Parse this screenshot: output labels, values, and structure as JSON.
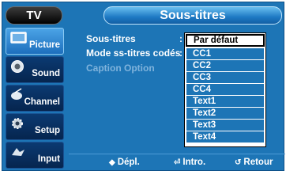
{
  "header": {
    "tv_label": "TV",
    "title": "Sous-titres"
  },
  "sidebar": {
    "items": [
      {
        "label": "Picture",
        "icon": "picture-icon",
        "active": true
      },
      {
        "label": "Sound",
        "icon": "sound-icon",
        "active": false
      },
      {
        "label": "Channel",
        "icon": "channel-icon",
        "active": false
      },
      {
        "label": "Setup",
        "icon": "setup-icon",
        "active": false
      },
      {
        "label": "Input",
        "icon": "input-icon",
        "active": false
      }
    ]
  },
  "menu": {
    "rows": [
      {
        "label": "Sous-titres",
        "enabled": true
      },
      {
        "label": "Mode ss-titres codés",
        "enabled": true
      },
      {
        "label": "Caption Option",
        "enabled": false
      }
    ],
    "colon": ":"
  },
  "dropdown": {
    "selected": "Par défaut",
    "options": [
      "Par défaut",
      "CC1",
      "CC2",
      "CC3",
      "CC4",
      "Text1",
      "Text2",
      "Text3",
      "Text4"
    ]
  },
  "footer": {
    "move": {
      "glyph": "◆",
      "label": "Dépl."
    },
    "enter": {
      "glyph": "⏎",
      "label": "Intro."
    },
    "return": {
      "glyph": "↺",
      "label": "Retour"
    }
  },
  "colors": {
    "panel": "#1d75b6",
    "highlight": "#1d75b6",
    "selected_bg": "#ffffff"
  }
}
